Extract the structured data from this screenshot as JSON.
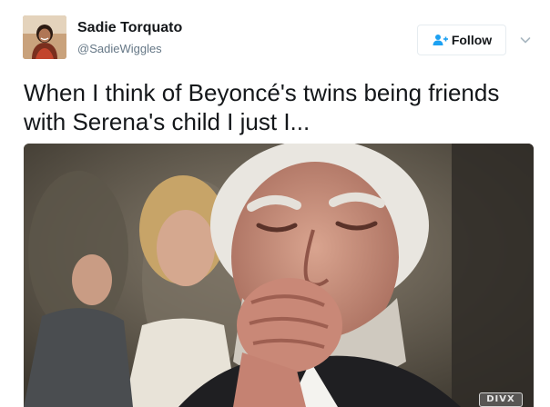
{
  "tweet": {
    "author": {
      "display_name": "Sadie Torquato",
      "handle": "@SadieWiggles",
      "avatar_icon": "profile-photo"
    },
    "follow_button": {
      "label": "Follow",
      "icon": "add-user-icon",
      "accent_color": "#1da1f2"
    },
    "menu_caret_icon": "chevron-down-icon",
    "text_lines": [
      "When I think of Beyoncé's twins being friends",
      "with Serena's child I just I..."
    ],
    "media": {
      "type": "gif",
      "watermark": "DIVX"
    }
  }
}
